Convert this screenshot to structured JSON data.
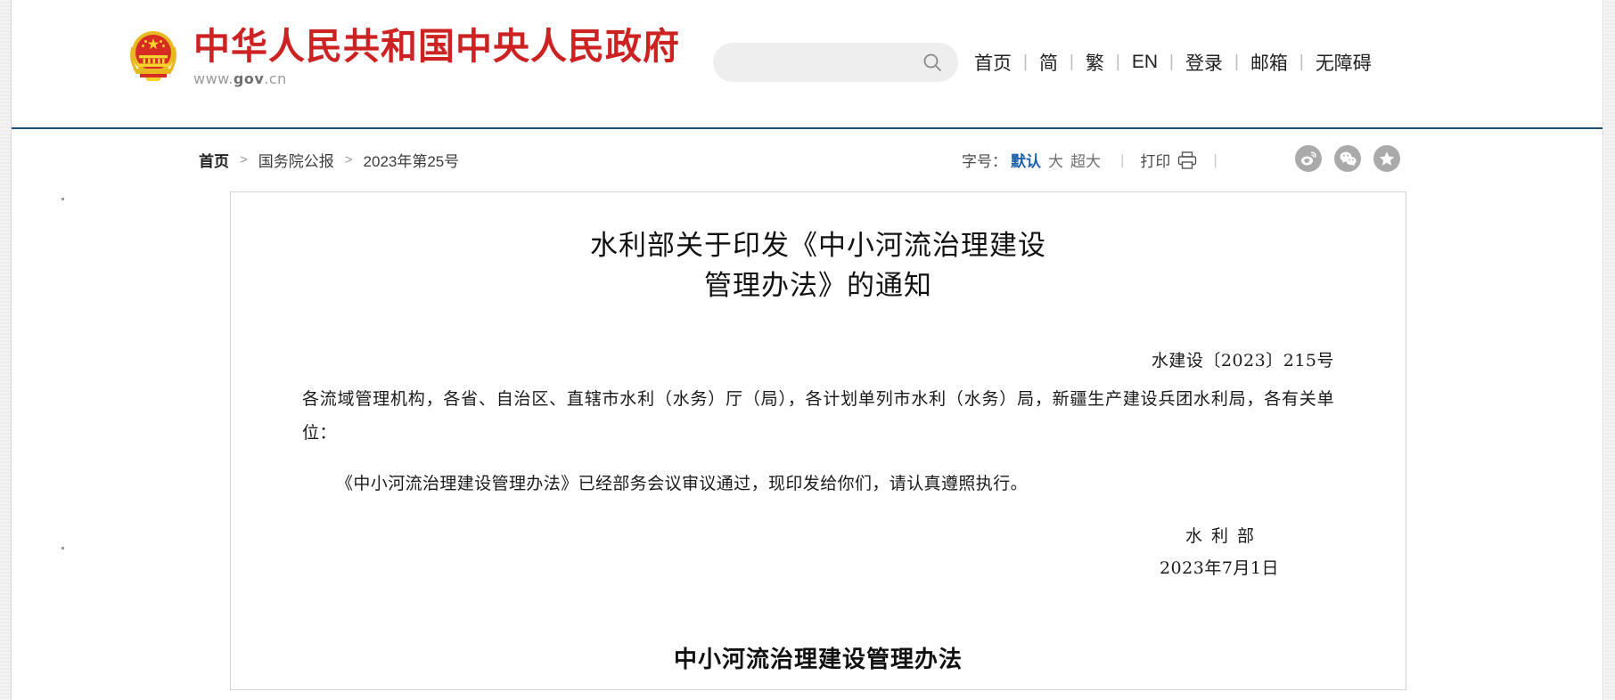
{
  "site": {
    "brand_title": "中华人民共和国中央人民政府",
    "brand_url_prefix": "www.",
    "brand_url_mid": "gov",
    "brand_url_suffix": ".cn",
    "emblem_icon": "national-emblem-icon",
    "brand_color": "#cc2222",
    "divider_color": "#1f4f7a"
  },
  "search": {
    "value": "",
    "placeholder": "",
    "icon": "search-icon"
  },
  "top_nav": {
    "items": [
      {
        "label": "首页"
      },
      {
        "label": "简"
      },
      {
        "label": "繁"
      },
      {
        "label": "EN"
      },
      {
        "label": "登录"
      },
      {
        "label": "邮箱"
      },
      {
        "label": "无障碍"
      }
    ],
    "separator": "|"
  },
  "breadcrumb": {
    "arrow": ">",
    "items": [
      {
        "label": "首页"
      },
      {
        "label": "国务院公报"
      },
      {
        "label": "2023年第25号"
      }
    ]
  },
  "toolbar": {
    "font_size_label": "字号：",
    "font_sizes": [
      {
        "label": "默认",
        "active": true
      },
      {
        "label": "大",
        "active": false
      },
      {
        "label": "超大",
        "active": false
      }
    ],
    "separator": "|",
    "print_label": "打印",
    "print_icon": "printer-icon",
    "share": [
      {
        "name": "weibo-icon"
      },
      {
        "name": "wechat-icon"
      },
      {
        "name": "favorite-star-icon"
      }
    ],
    "active_color": "#1b5faa"
  },
  "article": {
    "title_line1": "水利部关于印发《中小河流治理建设",
    "title_line2": "管理办法》的通知",
    "doc_number": "水建设〔2023〕215号",
    "recipients": "各流域管理机构，各省、自治区、直辖市水利（水务）厅（局），各计划单列市水利（水务）局，新疆生产建设兵团水利局，各有关单位：",
    "body": "《中小河流治理建设管理办法》已经部务会议审议通过，现印发给你们，请认真遵照执行。",
    "signature_org": "水利部",
    "signature_date": "2023年7月1日",
    "section_title": "中小河流治理建设管理办法"
  }
}
